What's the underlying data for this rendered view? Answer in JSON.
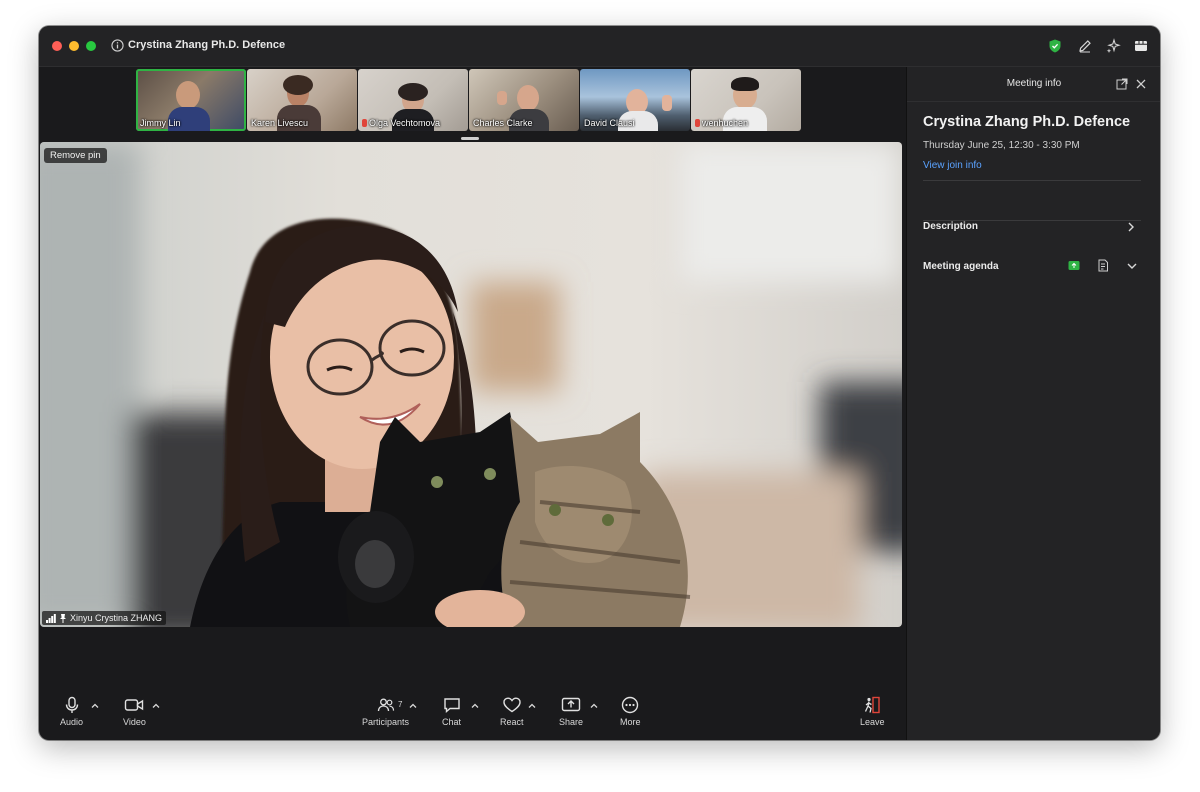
{
  "window": {
    "title": "Crystina Zhang Ph.D. Defence"
  },
  "thumbnails": [
    {
      "name": "Jimmy Lin",
      "muted": false,
      "active": true
    },
    {
      "name": "Karen Livescu",
      "muted": false,
      "active": false
    },
    {
      "name": "Olga Vechtomova",
      "muted": true,
      "active": false
    },
    {
      "name": "Charles Clarke",
      "muted": false,
      "active": false
    },
    {
      "name": "David Clausi",
      "muted": false,
      "active": false
    },
    {
      "name": "wenhuchen",
      "muted": true,
      "active": false
    }
  ],
  "main_video": {
    "remove_pin_label": "Remove pin",
    "speaker_name": "Xinyu Crystina ZHANG"
  },
  "panel": {
    "header_title": "Meeting info",
    "meeting_title": "Crystina Zhang Ph.D. Defence",
    "meeting_time": "Thursday June 25, 12:30 - 3:30 PM",
    "join_link_label": "View join info",
    "description_label": "Description",
    "agenda_label": "Meeting agenda"
  },
  "toolbar": {
    "audio_label": "Audio",
    "video_label": "Video",
    "participants_label": "Participants",
    "participants_count": "7",
    "chat_label": "Chat",
    "react_label": "React",
    "share_label": "Share",
    "more_label": "More",
    "leave_label": "Leave"
  },
  "colors": {
    "accent_green": "#2fb344",
    "link_blue": "#5aa2ff",
    "leave_red": "#e0453a"
  }
}
